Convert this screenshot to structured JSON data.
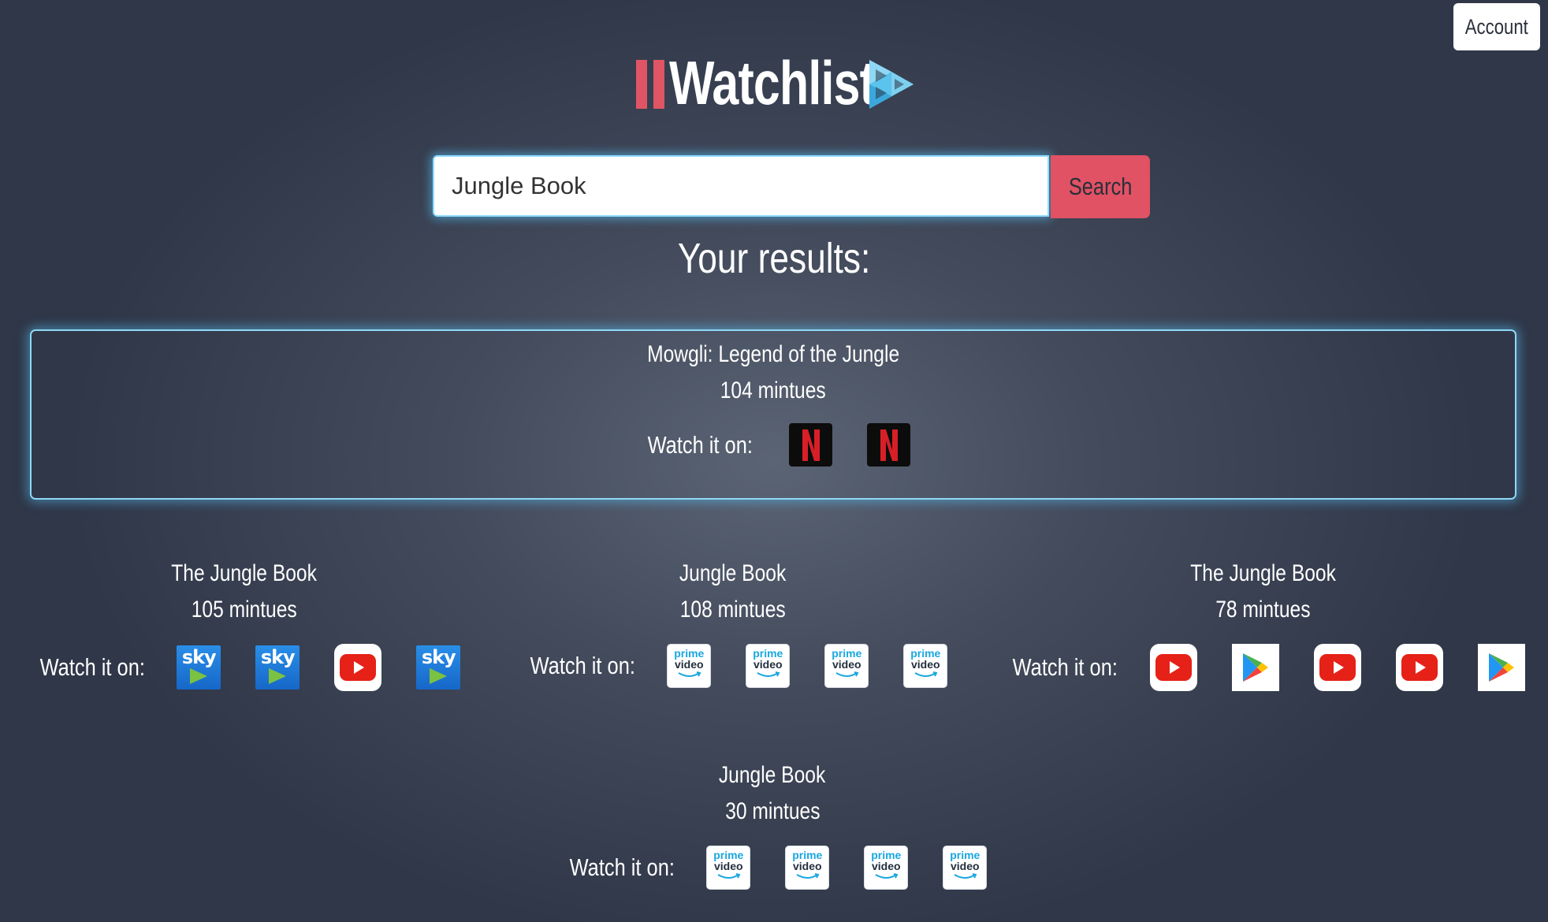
{
  "header": {
    "account_label": "Account",
    "logo_text": "Watchlist"
  },
  "search": {
    "value": "Jungle Book",
    "placeholder": "",
    "button_label": "Search"
  },
  "results_heading": "Your results:",
  "watch_label": "Watch it on:",
  "results": [
    {
      "title": "Mowgli: Legend of the Jungle",
      "runtime": "104 mintues",
      "providers": [
        "netflix-icon",
        "netflix-icon"
      ],
      "featured": true
    },
    {
      "title": "The Jungle Book",
      "runtime": "105 mintues",
      "providers": [
        "sky-icon",
        "sky-icon",
        "youtube-icon",
        "sky-icon"
      ]
    },
    {
      "title": "Jungle Book",
      "runtime": "108 mintues",
      "providers": [
        "prime-video-icon",
        "prime-video-icon",
        "prime-video-icon",
        "prime-video-icon"
      ]
    },
    {
      "title": "The Jungle Book",
      "runtime": "78 mintues",
      "providers": [
        "youtube-icon",
        "google-play-icon",
        "youtube-icon",
        "youtube-icon",
        "google-play-icon"
      ]
    },
    {
      "title": "Jungle Book",
      "runtime": "30 mintues",
      "providers": [
        "prime-video-icon",
        "prime-video-icon",
        "prime-video-icon",
        "prime-video-icon"
      ]
    }
  ],
  "colors": {
    "accent_red": "#e05264",
    "glow_blue": "#8ed8f4",
    "logo_play_blue": "#5bc3ec"
  }
}
